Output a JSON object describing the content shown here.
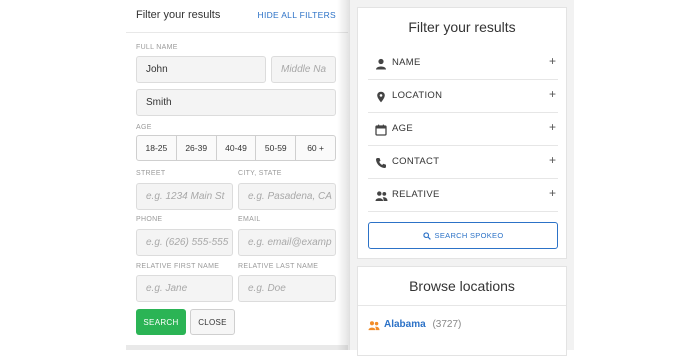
{
  "left_panel": {
    "title": "Filter your results",
    "hide_all": "HIDE ALL FILTERS",
    "full_name_label": "FULL NAME",
    "first_name_value": "John",
    "middle_name_placeholder": "Middle Na",
    "last_name_value": "Smith",
    "age_label": "AGE",
    "age_options": [
      "18-25",
      "26-39",
      "40-49",
      "50-59",
      "60 +"
    ],
    "street_label": "STREET",
    "street_placeholder": "e.g. 1234 Main St",
    "city_label": "CITY, STATE",
    "city_placeholder": "e.g. Pasadena, CA",
    "phone_label": "PHONE",
    "phone_placeholder": "e.g. (626) 555-555",
    "email_label": "EMAIL",
    "email_placeholder": "e.g. email@examp",
    "relative_first_label": "RELATIVE FIRST NAME",
    "relative_first_placeholder": "e.g. Jane",
    "relative_last_label": "RELATIVE LAST NAME",
    "relative_last_placeholder": "e.g. Doe",
    "search_button": "SEARCH",
    "close_button": "CLOSE"
  },
  "right_panel": {
    "title": "Filter your results",
    "rows": [
      {
        "label": "NAME",
        "icon": "person-icon",
        "action": "+"
      },
      {
        "label": "LOCATION",
        "icon": "location-pin-icon",
        "action": "+"
      },
      {
        "label": "AGE",
        "icon": "calendar-icon",
        "action": "+"
      },
      {
        "label": "CONTACT",
        "icon": "phone-icon",
        "action": "+"
      },
      {
        "label": "RELATIVE",
        "icon": "people-icon",
        "action": "+"
      }
    ],
    "search_button": "SEARCH SPOKEO",
    "browse_title": "Browse locations",
    "location": {
      "name": "Alabama",
      "count": "(3727)"
    }
  },
  "colors": {
    "accent_blue": "#2c72c7",
    "search_green": "#2bb455",
    "location_orange": "#f28c28"
  }
}
